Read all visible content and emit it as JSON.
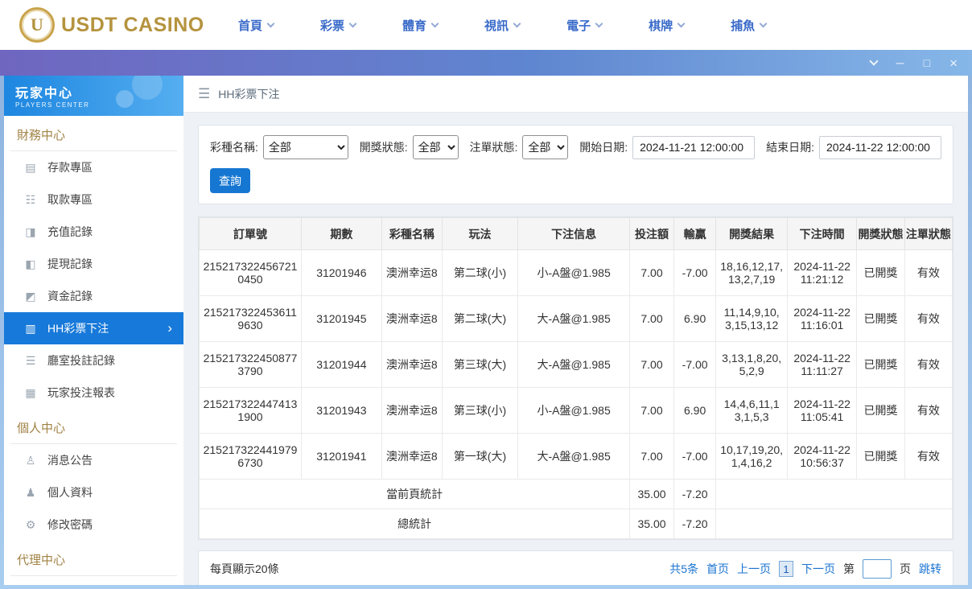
{
  "colors": {
    "accent_blue": "#1677d2",
    "selected_blue": "#1779d9",
    "gold": "#b5933f",
    "section_gold": "#a08244"
  },
  "top_nav": {
    "logo": {
      "text": "USDT CASINO",
      "badge_letter": "U"
    },
    "items": [
      {
        "label": "首頁"
      },
      {
        "label": "彩票"
      },
      {
        "label": "體育"
      },
      {
        "label": "視訊"
      },
      {
        "label": "電子"
      },
      {
        "label": "棋牌"
      },
      {
        "label": "捕魚"
      }
    ]
  },
  "titlebar": {
    "minimize": "─",
    "maximize": "□",
    "close": "×"
  },
  "sidebar": {
    "header": {
      "title": "玩家中心",
      "subtitle": "PLAYERS CENTER"
    },
    "sections": [
      {
        "label": "財務中心",
        "items": [
          {
            "label": "存款專區",
            "icon_name": "deposit-icon",
            "icon": "▤"
          },
          {
            "label": "取款專區",
            "icon_name": "withdraw-icon",
            "icon": "☷"
          },
          {
            "label": "充值記錄",
            "icon_name": "recharge-record-icon",
            "icon": "◨"
          },
          {
            "label": "提現記錄",
            "icon_name": "cashout-record-icon",
            "icon": "◧"
          },
          {
            "label": "資金記錄",
            "icon_name": "funds-record-icon",
            "icon": "◩"
          },
          {
            "label": "HH彩票下注",
            "icon_name": "lottery-bets-icon",
            "icon": "▥",
            "selected": true,
            "arrow": "›"
          },
          {
            "label": "廳室投註記錄",
            "icon_name": "room-bet-record-icon",
            "icon": "☰"
          },
          {
            "label": "玩家投注報表",
            "icon_name": "player-bet-report-icon",
            "icon": "▦"
          }
        ]
      },
      {
        "label": "個人中心",
        "items": [
          {
            "label": "消息公告",
            "icon_name": "announcement-icon",
            "icon": "♙"
          },
          {
            "label": "個人資料",
            "icon_name": "profile-icon",
            "icon": "♟"
          },
          {
            "label": "修改密碼",
            "icon_name": "change-password-icon",
            "icon": "⚙"
          }
        ]
      },
      {
        "label": "代理中心",
        "items": []
      }
    ]
  },
  "breadcrumb": {
    "menu_icon": "☰",
    "title": "HH彩票下注"
  },
  "filters": {
    "lottery_name": {
      "label": "彩種名稱:",
      "value": "全部"
    },
    "draw_status": {
      "label": "開獎狀態:",
      "value": "全部"
    },
    "order_status": {
      "label": "注單狀態:",
      "value": "全部"
    },
    "start_date": {
      "label": "開始日期:",
      "value": "2024-11-21 12:00:00"
    },
    "end_date": {
      "label": "結束日期:",
      "value": "2024-11-22 12:00:00"
    },
    "search_button": "查詢"
  },
  "table": {
    "headers": [
      "訂單號",
      "期數",
      "彩種名稱",
      "玩法",
      "下注信息",
      "投注額",
      "輸贏",
      "開獎結果",
      "下注時間",
      "開獎狀態",
      "注單狀態"
    ],
    "rows": [
      {
        "order": "2152173224567210450",
        "period": "31201946",
        "lottery": "澳洲幸运8",
        "play": "第二球(小)",
        "bet_info": "小-A盤@1.985",
        "bet_amount": "7.00",
        "win_loss": "-7.00",
        "result": "18,16,12,17,13,2,7,19",
        "bet_time": "2024-11-22 11:21:12",
        "draw_status": "已開獎",
        "order_status": "有效"
      },
      {
        "order": "2152173224536119630",
        "period": "31201945",
        "lottery": "澳洲幸运8",
        "play": "第二球(大)",
        "bet_info": "大-A盤@1.985",
        "bet_amount": "7.00",
        "win_loss": "6.90",
        "result": "11,14,9,10,3,15,13,12",
        "bet_time": "2024-11-22 11:16:01",
        "draw_status": "已開獎",
        "order_status": "有效"
      },
      {
        "order": "2152173224508773790",
        "period": "31201944",
        "lottery": "澳洲幸运8",
        "play": "第三球(大)",
        "bet_info": "大-A盤@1.985",
        "bet_amount": "7.00",
        "win_loss": "-7.00",
        "result": "3,13,1,8,20,5,2,9",
        "bet_time": "2024-11-22 11:11:27",
        "draw_status": "已開獎",
        "order_status": "有效"
      },
      {
        "order": "2152173224474131900",
        "period": "31201943",
        "lottery": "澳洲幸运8",
        "play": "第三球(小)",
        "bet_info": "小-A盤@1.985",
        "bet_amount": "7.00",
        "win_loss": "6.90",
        "result": "14,4,6,11,13,1,5,3",
        "bet_time": "2024-11-22 11:05:41",
        "draw_status": "已開獎",
        "order_status": "有效"
      },
      {
        "order": "2152173224419796730",
        "period": "31201941",
        "lottery": "澳洲幸运8",
        "play": "第一球(大)",
        "bet_info": "大-A盤@1.985",
        "bet_amount": "7.00",
        "win_loss": "-7.00",
        "result": "10,17,19,20,1,4,16,2",
        "bet_time": "2024-11-22 10:56:37",
        "draw_status": "已開獎",
        "order_status": "有效"
      }
    ],
    "summary": [
      {
        "label": "當前頁統計",
        "bet_amount": "35.00",
        "win_loss": "-7.20"
      },
      {
        "label": "總統計",
        "bet_amount": "35.00",
        "win_loss": "-7.20"
      }
    ]
  },
  "pagination": {
    "page_size_text": "每頁顯示20條",
    "total_text": "共5条",
    "first": "首页",
    "prev": "上一页",
    "current_page": "1",
    "next": "下一页",
    "jump_prefix": "第",
    "jump_suffix": "页",
    "jump_button": "跳转"
  }
}
